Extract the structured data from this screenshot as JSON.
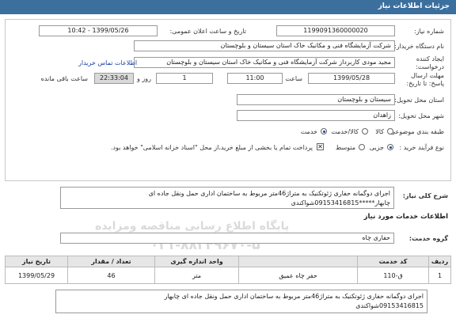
{
  "header": {
    "title": "جزئیات اطلاعات نیاز"
  },
  "form": {
    "need_number_label": "شماره نیاز:",
    "need_number": "1199091360000020",
    "announce_label": "تاریخ و ساعت اعلان عمومی:",
    "announce_value": "1399/05/26 - 10:42",
    "buyer_label": "نام دستگاه خریدار:",
    "buyer_value": "شرکت آزمایشگاه فنی و مکانیک خاک استان سیستان و بلوچستان",
    "creator_label": "ایجاد کننده درخواست:",
    "creator_value": "مجید مودی کاربرداز شرکت آزمایشگاه فنی و مکانیک خاک استان سیستان و بلوچستان",
    "contact_link": "اطلاعات تماس خریدار",
    "deadline_label": "مهلت ارسال پاسخ: تا تاریخ:",
    "deadline_date": "1399/05/28",
    "time_label": "ساعت",
    "deadline_time": "11:00",
    "days_value": "1",
    "days_label": "روز و",
    "remaining_time": "22:33:04",
    "remaining_label": "ساعت باقی مانده",
    "province_label": "استان محل تحویل:",
    "province_value": "سیستان و بلوچستان",
    "city_label": "شهر محل تحویل:",
    "city_value": "زاهدان",
    "category_label": "طبقه بندی موضوعی:",
    "category_options": [
      "کالا",
      "کالا/خدمت",
      "خدمت"
    ],
    "category_selected": "خدمت",
    "process_label": "نوع فرآیند خرید :",
    "process_options": [
      "جزیی",
      "متوسط"
    ],
    "process_selected": "جزیی",
    "payment_note": "پرداخت تمام یا بخشی از مبلغ خرید،از محل \"اسناد خزانه اسلامی\" خواهد بود."
  },
  "general_desc": {
    "label": "شرح کلی نیاز:",
    "line1": "اجرای دوگمانه حفاری ژئوتکنیک به متراژ46متر مربوط به ساختمان اداری حمل ونقل جاده ای",
    "line2": "چابهار*****09153416815شواکندی"
  },
  "services_section": {
    "title": "اطلاعات خدمات مورد نیاز"
  },
  "service_group": {
    "label": "گروه خدمت:",
    "value": "حفاری چاه"
  },
  "items_table": {
    "headers": [
      "ردیف",
      "کد خدمت",
      "واحد اندازه گیری",
      "تعداد / مقدار",
      "تاریخ نیاز"
    ],
    "rows": [
      {
        "row": "1",
        "code": "ق-110",
        "name": "حفر چاه عمیق",
        "unit": "متر",
        "qty": "46",
        "date": "1399/05/29"
      }
    ]
  },
  "item_desc": {
    "line1": "اجرای دوگمانه حفاری ژئوتکنیک به متراژ46متر مربوط به ساختمان اداری حمل ونقل جاده ای چابهار",
    "line2": "09153416815شواکندی"
  },
  "watermark": {
    "line1": "پایگاه اطلاع رسانی مناقصه ومزایده",
    "line2": "۰۲۱-۸۸۳۴۹۶۷۰-۵"
  }
}
